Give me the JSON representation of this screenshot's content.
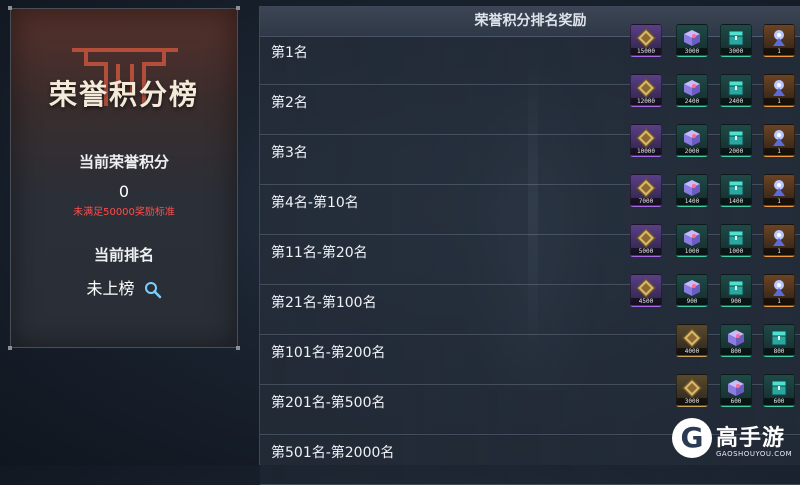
{
  "left_card": {
    "title": "荣誉积分榜",
    "points_label": "当前荣誉积分",
    "points_value": "0",
    "points_warning": "未满足50000奖励标准",
    "rank_label": "当前排名",
    "rank_value": "未上榜",
    "search_icon": "magnifier-icon"
  },
  "panel": {
    "title": "荣誉积分排名奖励",
    "rows": [
      {
        "label": "第1名",
        "items": [
          {
            "type": "medal",
            "rarity": "purple",
            "qty": "15000"
          },
          {
            "type": "cube",
            "rarity": "green",
            "qty": "3000"
          },
          {
            "type": "chest",
            "rarity": "green",
            "qty": "3000"
          },
          {
            "type": "orb",
            "rarity": "orange",
            "qty": "1"
          }
        ]
      },
      {
        "label": "第2名",
        "items": [
          {
            "type": "medal",
            "rarity": "purple",
            "qty": "12000"
          },
          {
            "type": "cube",
            "rarity": "green",
            "qty": "2400"
          },
          {
            "type": "chest",
            "rarity": "green",
            "qty": "2400"
          },
          {
            "type": "orb",
            "rarity": "orange",
            "qty": "1"
          }
        ]
      },
      {
        "label": "第3名",
        "items": [
          {
            "type": "medal",
            "rarity": "purple",
            "qty": "10000"
          },
          {
            "type": "cube",
            "rarity": "green",
            "qty": "2000"
          },
          {
            "type": "chest",
            "rarity": "green",
            "qty": "2000"
          },
          {
            "type": "orb",
            "rarity": "orange",
            "qty": "1"
          }
        ]
      },
      {
        "label": "第4名-第10名",
        "items": [
          {
            "type": "medal",
            "rarity": "purple",
            "qty": "7000"
          },
          {
            "type": "cube",
            "rarity": "green",
            "qty": "1400"
          },
          {
            "type": "chest",
            "rarity": "green",
            "qty": "1400"
          },
          {
            "type": "orb",
            "rarity": "orange",
            "qty": "1"
          }
        ]
      },
      {
        "label": "第11名-第20名",
        "items": [
          {
            "type": "medal",
            "rarity": "purple",
            "qty": "5000"
          },
          {
            "type": "cube",
            "rarity": "green",
            "qty": "1000"
          },
          {
            "type": "chest",
            "rarity": "green",
            "qty": "1000"
          },
          {
            "type": "orb",
            "rarity": "orange",
            "qty": "1"
          }
        ]
      },
      {
        "label": "第21名-第100名",
        "items": [
          {
            "type": "medal",
            "rarity": "purple",
            "qty": "4500"
          },
          {
            "type": "cube",
            "rarity": "green",
            "qty": "900"
          },
          {
            "type": "chest",
            "rarity": "green",
            "qty": "900"
          },
          {
            "type": "orb",
            "rarity": "orange",
            "qty": "1"
          }
        ]
      },
      {
        "label": "第101名-第200名",
        "items": [
          {
            "type": "medal",
            "rarity": "gold",
            "qty": "4000"
          },
          {
            "type": "cube",
            "rarity": "green",
            "qty": "800"
          },
          {
            "type": "chest",
            "rarity": "green",
            "qty": "800"
          }
        ]
      },
      {
        "label": "第201名-第500名",
        "items": [
          {
            "type": "medal",
            "rarity": "gold",
            "qty": "3000"
          },
          {
            "type": "cube",
            "rarity": "green",
            "qty": "600"
          },
          {
            "type": "chest",
            "rarity": "green",
            "qty": "600"
          }
        ]
      },
      {
        "label": "第501名-第2000名",
        "items": []
      }
    ]
  },
  "watermark": {
    "logo_letter": "G",
    "brand": "高手游",
    "url": "GAOSHOUYOU.COM"
  },
  "colors": {
    "warning": "#ff4d4d",
    "purple_border": "#a96ae6",
    "green_border": "#3fd0a8",
    "orange_border": "#f29a3a"
  }
}
